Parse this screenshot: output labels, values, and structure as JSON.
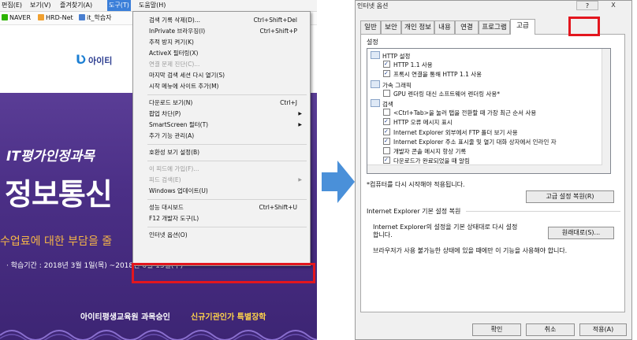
{
  "browser": {
    "menubar": [
      "편집(E)",
      "보기(V)",
      "즐겨찾기(A)",
      "도구(T)",
      "도움말(H)"
    ],
    "active_menu": "도구(T)",
    "favorites": [
      "NAVER",
      "HRD-Net",
      "it_학습자"
    ],
    "logo_text": "아이티",
    "banner": {
      "subtitle": "IT평가인정과목 ",
      "title": "정보통신",
      "line": "수업료에 대한 부담을 줄",
      "period": "· 학습기간 : 2018년 3월 1일(목) ~2018년 6월 13일(수)",
      "footer_left": "아이티평생교육원 과목승인",
      "footer_right": "신규기관인가 특별장학"
    },
    "tools_menu": [
      {
        "label": "검색 기록 삭제(D)...",
        "shortcut": "Ctrl+Shift+Del"
      },
      {
        "label": "InPrivate 브라우징(I)",
        "shortcut": "Ctrl+Shift+P"
      },
      {
        "label": "추적 방지 켜기(K)"
      },
      {
        "label": "ActiveX 필터링(X)"
      },
      {
        "label": "연결 문제 진단(C)...",
        "disabled": true
      },
      {
        "label": "마지막 검색 세션 다시 열기(S)"
      },
      {
        "label": "시작 메뉴에 사이트 추가(M)"
      },
      {
        "separator": true
      },
      {
        "label": "다운로드 보기(N)",
        "shortcut": "Ctrl+J"
      },
      {
        "label": "팝업 차단(P)",
        "submenu": true
      },
      {
        "label": "SmartScreen 필터(T)",
        "submenu": true
      },
      {
        "label": "추가 기능 관리(A)"
      },
      {
        "separator": true
      },
      {
        "label": "호환성 보기 설정(B)"
      },
      {
        "separator": true
      },
      {
        "label": "이 피드에 가입(F)...",
        "disabled": true
      },
      {
        "label": "피드 검색(E)",
        "disabled": true,
        "submenu": true
      },
      {
        "label": "Windows 업데이트(U)"
      },
      {
        "separator": true
      },
      {
        "label": "성능 대시보드",
        "shortcut": "Ctrl+Shift+U"
      },
      {
        "label": "F12 개발자 도구(L)"
      },
      {
        "separator": true
      },
      {
        "label": "인터넷 옵션(O)"
      }
    ]
  },
  "dialog": {
    "title": "인터넷 옵션",
    "title_btn_help": "?",
    "title_btn_close": "X",
    "tabs": [
      "일반",
      "보안",
      "개인 정보",
      "내용",
      "연결",
      "프로그램",
      "고급"
    ],
    "active_tab": "고급",
    "settings_label": "설정",
    "tree": [
      {
        "type": "category",
        "label": "HTTP 설정",
        "level": 0
      },
      {
        "type": "check",
        "label": "HTTP 1.1 사용",
        "checked": true
      },
      {
        "type": "check",
        "label": "프록시 연결을 통해 HTTP 1.1 사용",
        "checked": true
      },
      {
        "type": "category",
        "label": "가속 그래픽",
        "level": 0
      },
      {
        "type": "check",
        "label": "GPU 렌더링 대신 소프트웨어 렌더링 사용*",
        "checked": false
      },
      {
        "type": "category",
        "label": "검색",
        "level": 0
      },
      {
        "type": "check",
        "label": "<Ctrl+Tab>을 눌러 탭을 전환할 때 가장 최근 순서 사용",
        "checked": false
      },
      {
        "type": "check",
        "label": "HTTP 오류 메시지 표시",
        "checked": true
      },
      {
        "type": "check",
        "label": "Internet Explorer 외부에서 FTP 폴더 보기 사용",
        "checked": true
      },
      {
        "type": "check",
        "label": "Internet Explorer 주소 표시줄 및 열기 대화 상자에서 인라인 자",
        "checked": true
      },
      {
        "type": "check",
        "label": "개발자 콘솔 메시지 항상 기록",
        "checked": false
      },
      {
        "type": "check",
        "label": "다운로드가 완료되었을 때 알림",
        "checked": true
      }
    ],
    "note": "*컴퓨터를 다시 시작해야 적용됩니다.",
    "restore_button": "고급 설정 복원(R)",
    "reset_heading": "Internet Explorer 기본 설정 복원",
    "reset_desc_line1": "Internet Explorer의 설정을 기본 상태대로 다시 설정",
    "reset_desc_line2": "합니다.",
    "reset_button": "원래대로(S)...",
    "reset_warning": "브라우저가 사용 불가능한 상태에 있을 때에만 이 기능을 사용해야 합니다.",
    "ok_button": "확인",
    "cancel_button": "취소",
    "apply_button": "적용(A)"
  },
  "colors": {
    "highlight": "#e3161e",
    "arrow": "#4a90d9",
    "banner": "#4b2f86",
    "menu_active": "#3b7fd9"
  }
}
